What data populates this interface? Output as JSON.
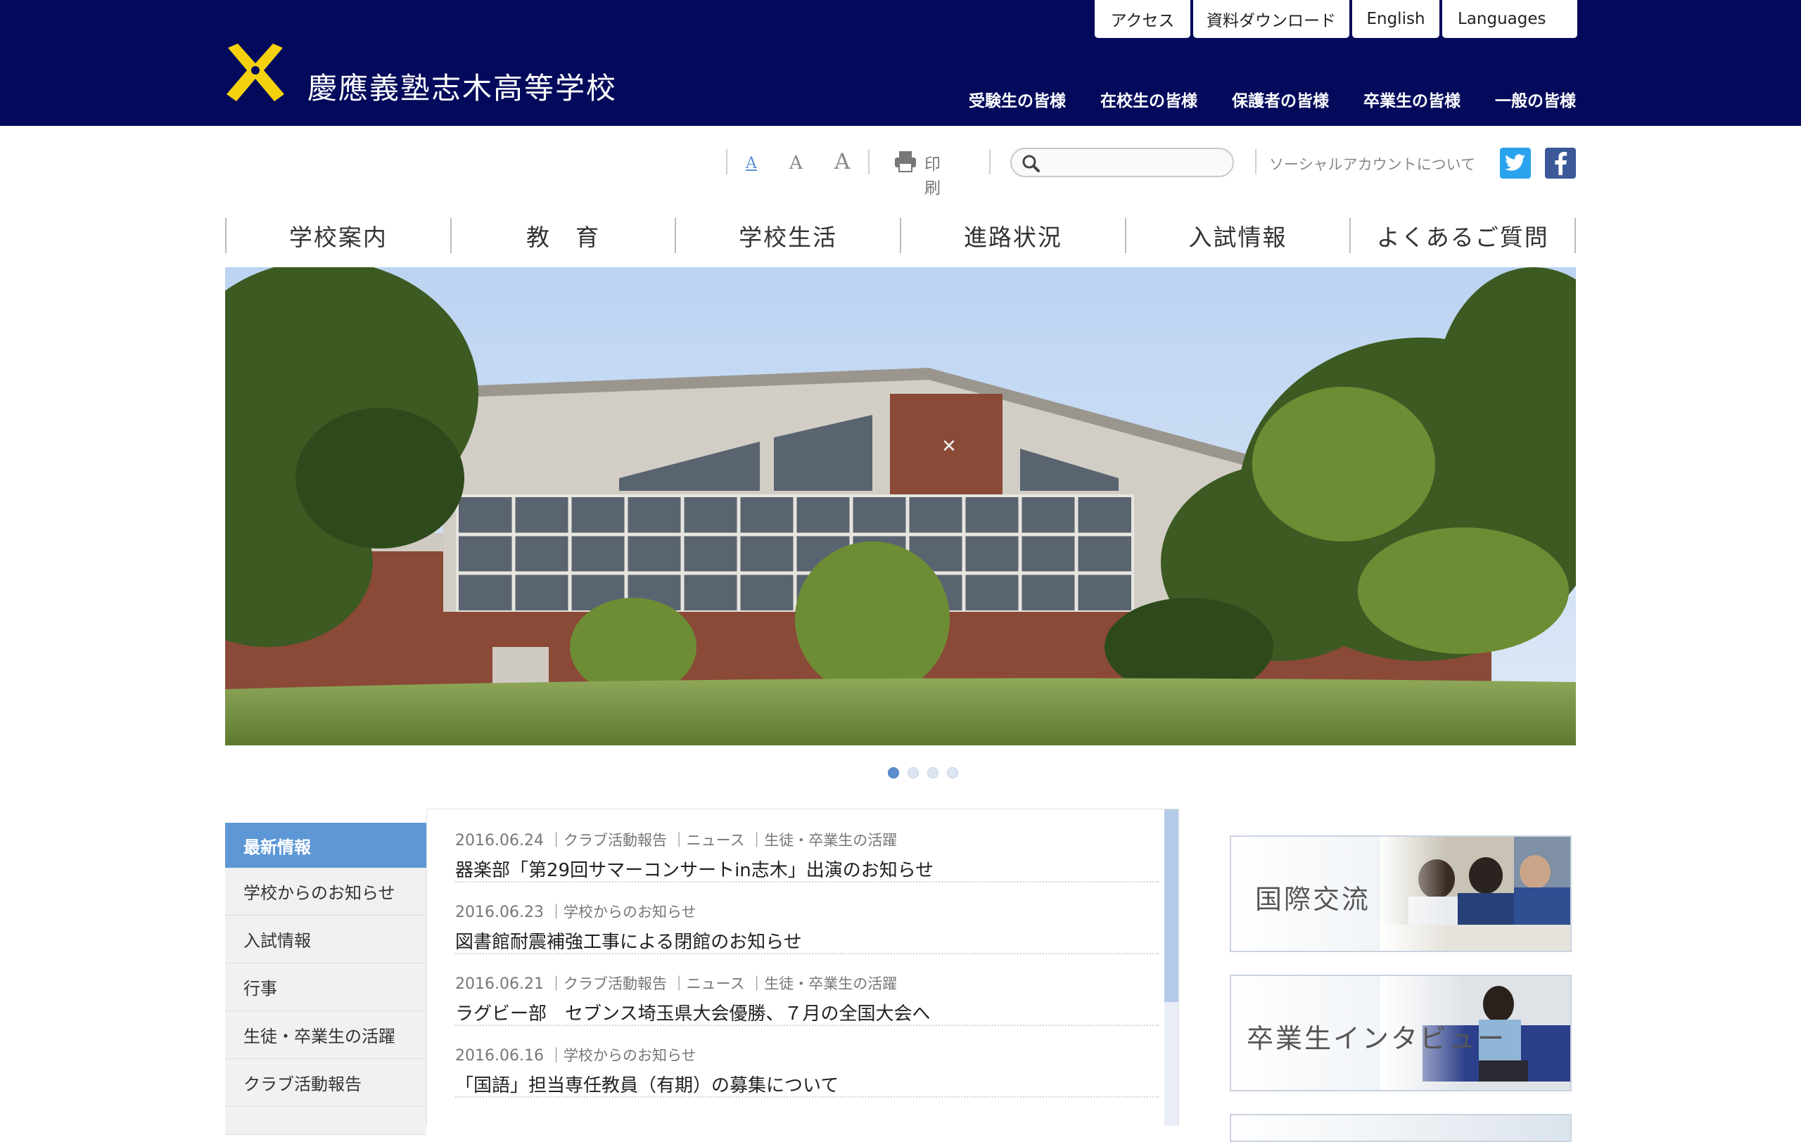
{
  "header": {
    "site_name": "慶應義塾志木高等学校",
    "utility_links": [
      "アクセス",
      "資料ダウンロード",
      "English",
      "Languages"
    ],
    "audience_links": [
      "受験生の皆様",
      "在校生の皆様",
      "保護者の皆様",
      "卒業生の皆様",
      "一般の皆様"
    ],
    "colors": {
      "header_bg": "#030a5b",
      "logo": "#f5d20e"
    }
  },
  "toolbar": {
    "font_sizes": [
      "A",
      "A",
      "A"
    ],
    "print_label": "印刷",
    "search_placeholder": "",
    "social_label": "ソーシャルアカウントについて",
    "twitter_icon": "twitter-icon",
    "facebook_icon": "facebook-icon"
  },
  "main_nav": [
    "学校案内",
    "教　育",
    "学校生活",
    "進路状況",
    "入試情報",
    "よくあるご質問"
  ],
  "slider": {
    "slide_count": 4,
    "active_index": 0
  },
  "news_categories": [
    "最新情報",
    "学校からのお知らせ",
    "入試情報",
    "行事",
    "生徒・卒業生の活躍",
    "クラブ活動報告"
  ],
  "news": [
    {
      "date": "2016.06.24",
      "categories": "｜クラブ活動報告 ｜ニュース ｜生徒・卒業生の活躍",
      "title": "器楽部「第29回サマーコンサートin志木」出演のお知らせ"
    },
    {
      "date": "2016.06.23",
      "categories": "｜学校からのお知らせ",
      "title": "図書館耐震補強工事による閉館のお知らせ"
    },
    {
      "date": "2016.06.21",
      "categories": "｜クラブ活動報告 ｜ニュース ｜生徒・卒業生の活躍",
      "title": "ラグビー部　セブンス埼玉県大会優勝、７月の全国大会へ"
    },
    {
      "date": "2016.06.16",
      "categories": "｜学校からのお知らせ",
      "title": "「国語」担当専任教員（有期）の募集について"
    }
  ],
  "banners": [
    "国際交流",
    "卒業生インタビュー"
  ],
  "colors": {
    "accent": "#5d97d6",
    "twitter": "#2aa3ef",
    "facebook": "#3b5998"
  }
}
